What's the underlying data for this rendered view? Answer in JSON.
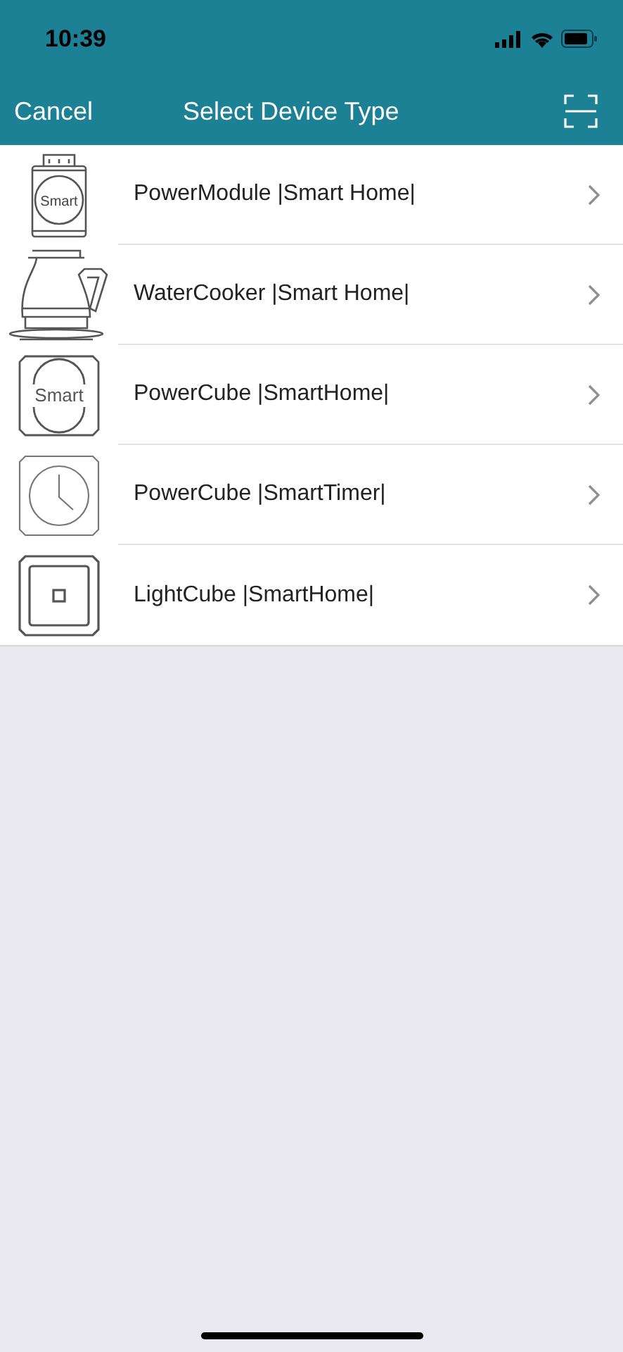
{
  "status_bar": {
    "time": "10:39"
  },
  "nav": {
    "cancel": "Cancel",
    "title": "Select Device Type"
  },
  "devices": [
    {
      "kind": "module",
      "label": "PowerModule |Smart Home|",
      "icon_text": "Smart"
    },
    {
      "kind": "kettle",
      "label": "WaterCooker |Smart Home|"
    },
    {
      "kind": "cube",
      "label": "PowerCube |SmartHome|",
      "icon_text": "Smart"
    },
    {
      "kind": "timer",
      "label": "PowerCube |SmartTimer|"
    },
    {
      "kind": "light",
      "label": "LightCube |SmartHome|"
    }
  ]
}
